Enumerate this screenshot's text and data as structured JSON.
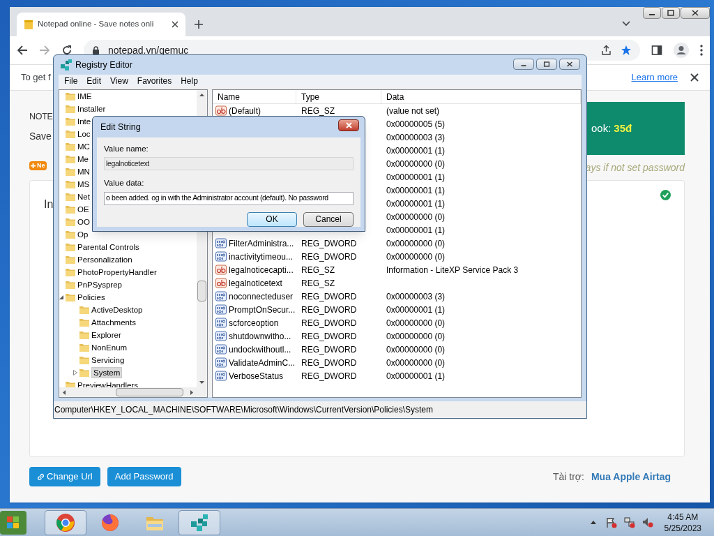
{
  "browser": {
    "tab": {
      "title": "Notepad online - Save notes onli"
    },
    "address": "notepad.vn/gemuc",
    "bookmarked": true,
    "infobar": {
      "text": "To get f",
      "link": "Learn more"
    },
    "page": {
      "heading": "NOTE",
      "subtitle": "Save",
      "badge": "Ne",
      "promo": {
        "label": "ook:",
        "price": "35đ"
      },
      "hint": "ays if not set password",
      "card": {
        "text": "In",
        "saved": true
      },
      "buttons": [
        {
          "label": "Change Url",
          "kind": "link"
        },
        {
          "label": "Add Password",
          "kind": "plain"
        }
      ],
      "sponsor": {
        "label": "Tài trợ:",
        "link": "Mua Apple Airtag"
      }
    }
  },
  "registry_editor": {
    "title": "Registry Editor",
    "menu": [
      "File",
      "Edit",
      "View",
      "Favorites",
      "Help"
    ],
    "tree": [
      {
        "label": "IME",
        "selected": false
      },
      {
        "label": "Installer",
        "selected": false
      },
      {
        "label": "Inte",
        "selected": false
      },
      {
        "label": "Loc",
        "selected": false
      },
      {
        "label": "MC",
        "selected": false
      },
      {
        "label": "Me",
        "selected": false
      },
      {
        "label": "MN",
        "selected": false
      },
      {
        "label": "MS",
        "selected": false
      },
      {
        "label": "Net",
        "selected": false
      },
      {
        "label": "OE",
        "selected": false
      },
      {
        "label": "OO",
        "selected": false
      },
      {
        "label": "Op",
        "selected": false
      },
      {
        "label": "Parental Controls",
        "selected": false
      },
      {
        "label": "Personalization",
        "selected": false
      },
      {
        "label": "PhotoPropertyHandler",
        "selected": false
      },
      {
        "label": "PnPSysprep",
        "selected": false
      },
      {
        "label": "Policies",
        "selected": false,
        "expanded": true,
        "children": [
          {
            "label": "ActiveDesktop",
            "selected": false
          },
          {
            "label": "Attachments",
            "selected": false
          },
          {
            "label": "Explorer",
            "selected": false
          },
          {
            "label": "NonEnum",
            "selected": false
          },
          {
            "label": "Servicing",
            "selected": false
          },
          {
            "label": "System",
            "selected": true,
            "expanded": false
          }
        ]
      },
      {
        "label": "PreviewHandlers",
        "selected": false
      }
    ],
    "columns": [
      "Name",
      "Type",
      "Data"
    ],
    "values": [
      {
        "kind": "string",
        "name": "(Default)",
        "type": "REG_SZ",
        "data": "(value not set)"
      },
      {
        "data": "0x00000005 (5)"
      },
      {
        "data": "0x00000003 (3)"
      },
      {
        "data": "0x00000001 (1)"
      },
      {
        "data": "0x00000000 (0)"
      },
      {
        "data": "0x00000001 (1)"
      },
      {
        "data": "0x00000001 (1)"
      },
      {
        "data": "0x00000001 (1)"
      },
      {
        "data": "0x00000000 (0)"
      },
      {
        "data": "0x00000001 (1)"
      },
      {
        "kind": "dword",
        "name": "FilterAdministra...",
        "type": "REG_DWORD",
        "data": "0x00000000 (0)"
      },
      {
        "kind": "dword",
        "name": "inactivitytimeou...",
        "type": "REG_DWORD",
        "data": "0x00000000 (0)"
      },
      {
        "kind": "string",
        "name": "legalnoticecapti...",
        "type": "REG_SZ",
        "data": "Information - LiteXP Service Pack 3"
      },
      {
        "kind": "string",
        "name": "legalnoticetext",
        "type": "REG_SZ"
      },
      {
        "kind": "dword",
        "name": "noconnecteduser",
        "type": "REG_DWORD",
        "data": "0x00000003 (3)"
      },
      {
        "kind": "dword",
        "name": "PromptOnSecur...",
        "type": "REG_DWORD",
        "data": "0x00000001 (1)"
      },
      {
        "kind": "dword",
        "name": "scforceoption",
        "type": "REG_DWORD",
        "data": "0x00000000 (0)"
      },
      {
        "kind": "dword",
        "name": "shutdownwitho...",
        "type": "REG_DWORD",
        "data": "0x00000000 (0)"
      },
      {
        "kind": "dword",
        "name": "undockwithoutl...",
        "type": "REG_DWORD",
        "data": "0x00000000 (0)"
      },
      {
        "kind": "dword",
        "name": "ValidateAdminC...",
        "type": "REG_DWORD",
        "data": "0x00000000 (0)"
      },
      {
        "kind": "dword",
        "name": "VerboseStatus",
        "type": "REG_DWORD",
        "data": "0x00000001 (1)"
      }
    ],
    "status_bar": "Computer\\HKEY_LOCAL_MACHINE\\SOFTWARE\\Microsoft\\Windows\\CurrentVersion\\Policies\\System"
  },
  "dialog": {
    "title": "Edit String",
    "fields": [
      {
        "label": "Value name:",
        "value": "legalnoticetext",
        "disabled": true
      },
      {
        "label": "Value data:",
        "value": "o been added. og in with the Administrator account (default). No password",
        "disabled": false
      }
    ],
    "buttons": [
      {
        "label": "OK",
        "default": true
      },
      {
        "label": "Cancel",
        "default": false
      }
    ]
  },
  "taskbar": {
    "apps": [
      {
        "kind": "chrome",
        "open": true
      },
      {
        "kind": "firefox",
        "open": false
      },
      {
        "kind": "explorer",
        "open": false
      },
      {
        "kind": "regedit",
        "open": true
      }
    ],
    "time": "4:45 AM",
    "date": "5/25/2023"
  }
}
